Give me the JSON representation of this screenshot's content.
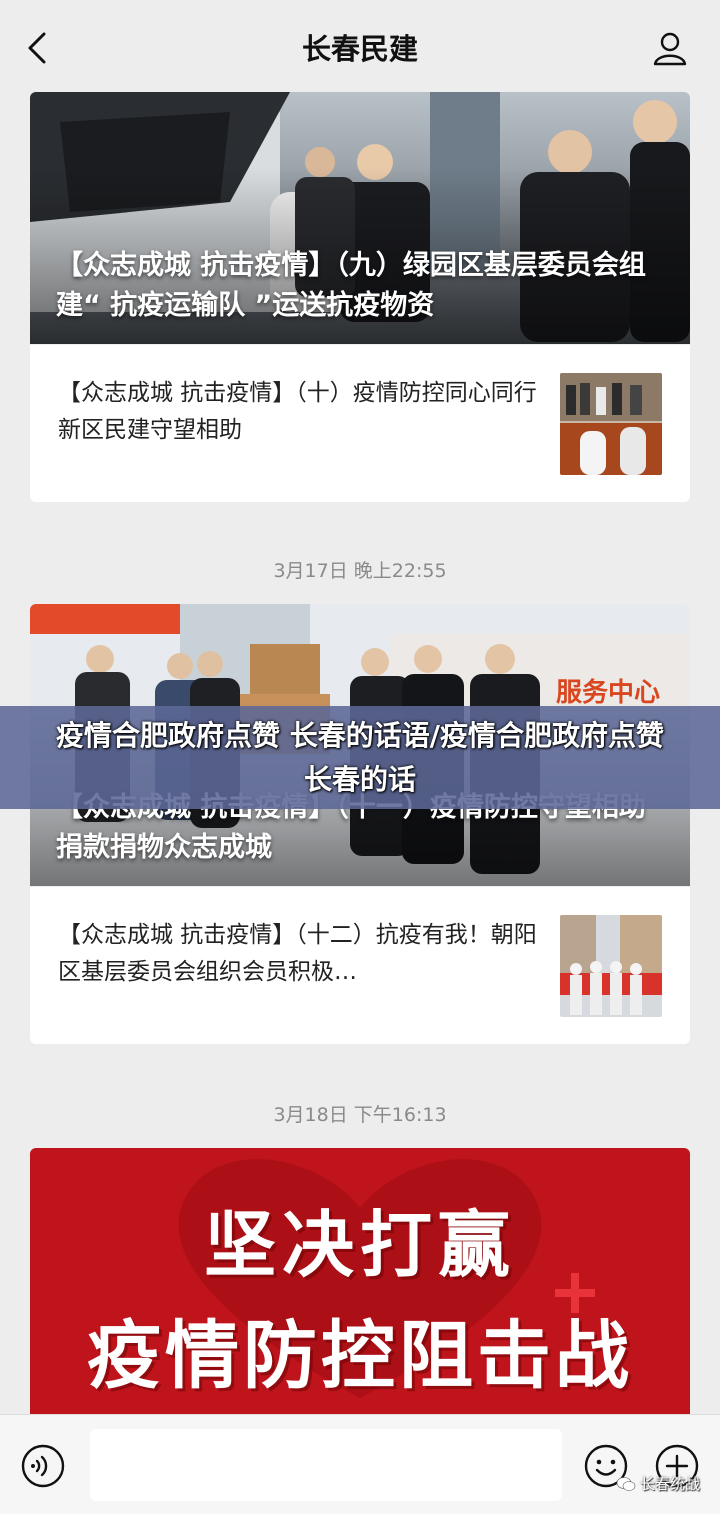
{
  "header": {
    "title": "长春民建"
  },
  "articles": [
    {
      "hero_title": "【众志成城 抗击疫情】（九）绿园区基层委员会组建“ 抗疫运输队 ”运送抗疫物资",
      "sub_title": "【众志成城 抗击疫情】（十）疫情防控同心同行 新区民建守望相助"
    },
    {
      "hero_title": "【众志成城 抗击疫情】（十一）疫情防控守望相助 捐款捐物众志成城",
      "hero_sign": "服务中心",
      "sub_title": "【众志成城 抗击疫情】（十二）抗疫有我！朝阳区基层委员会组织会员积极…"
    }
  ],
  "timestamps": [
    "3月17日 晚上22:55",
    "3月18日 下午16:13"
  ],
  "overlay": {
    "text": "疫情合肥政府点赞 长春的话语/疫情合肥政府点赞 长春的话"
  },
  "poster": {
    "line1": "坚决打赢",
    "line2": "疫情防控阻击战"
  },
  "bottom_bar": {
    "input_value": ""
  },
  "watermark": {
    "text": "长春统战"
  },
  "colors": {
    "poster_red": "#c0141c",
    "overlay_blue": "#5c6896",
    "page_bg": "#ededed"
  }
}
